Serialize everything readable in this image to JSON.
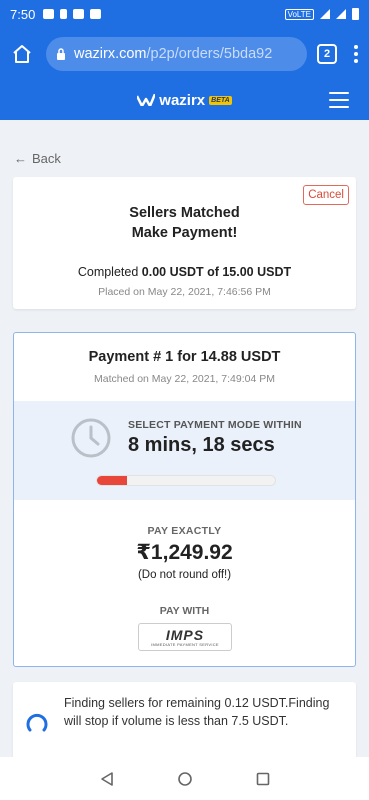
{
  "status_bar": {
    "time": "7:50",
    "network": "VoLTE"
  },
  "browser": {
    "url_domain": "wazirx.com",
    "url_path": "/p2p/orders/5bda92",
    "tab_count": "2"
  },
  "app": {
    "brand": "wazirx",
    "badge": "BETA"
  },
  "back": {
    "label": "Back"
  },
  "order_summary": {
    "cancel_label": "Cancel",
    "title_line1": "Sellers Matched",
    "title_line2": "Make Payment!",
    "completed_prefix": "Completed",
    "completed_amount": "0.00 USDT of 15.00 USDT",
    "placed_on": "Placed on May 22, 2021, 7:46:56 PM"
  },
  "payment": {
    "title": "Payment # 1 for 14.88 USDT",
    "matched_on": "Matched on May 22, 2021, 7:49:04 PM",
    "timer_label": "SELECT PAYMENT MODE WITHIN",
    "timer_value": "8 mins, 18 secs",
    "progress_fraction": 0.17,
    "pay_exactly_label": "PAY EXACTLY",
    "amount": "₹1,249.92",
    "note": "(Do not round off!)",
    "pay_with_label": "PAY WITH",
    "method_name": "IMPS",
    "method_subtitle": "IMMEDIATE PAYMENT SERVICE"
  },
  "finding": {
    "text": "Finding sellers for remaining 0.12 USDT.Finding will stop if volume is less than 7.5 USDT."
  },
  "colors": {
    "primary": "#1f6fe2",
    "danger": "#e8463a",
    "background": "#eef1f6"
  }
}
